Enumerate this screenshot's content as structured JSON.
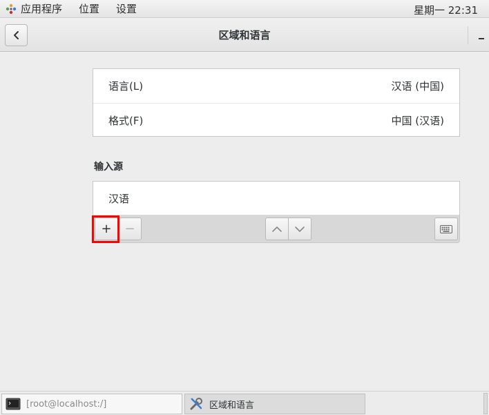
{
  "top_panel": {
    "menus": [
      "应用程序",
      "位置",
      "设置"
    ],
    "clock": "星期一 22:31"
  },
  "window": {
    "title": "区域和语言"
  },
  "language_section": {
    "rows": [
      {
        "label": "语言(L)",
        "value": "汉语 (中国)"
      },
      {
        "label": "格式(F)",
        "value": "中国 (汉语)"
      }
    ]
  },
  "input_sources": {
    "heading": "输入源",
    "items": [
      "汉语"
    ],
    "add_label": "+",
    "remove_label": "−"
  },
  "taskbar": {
    "tasks": [
      {
        "label": "[root@localhost:/]",
        "icon": "terminal-icon"
      },
      {
        "label": "区域和语言",
        "icon": "tools-icon"
      }
    ]
  },
  "colors": {
    "highlight": "#ff0000"
  }
}
